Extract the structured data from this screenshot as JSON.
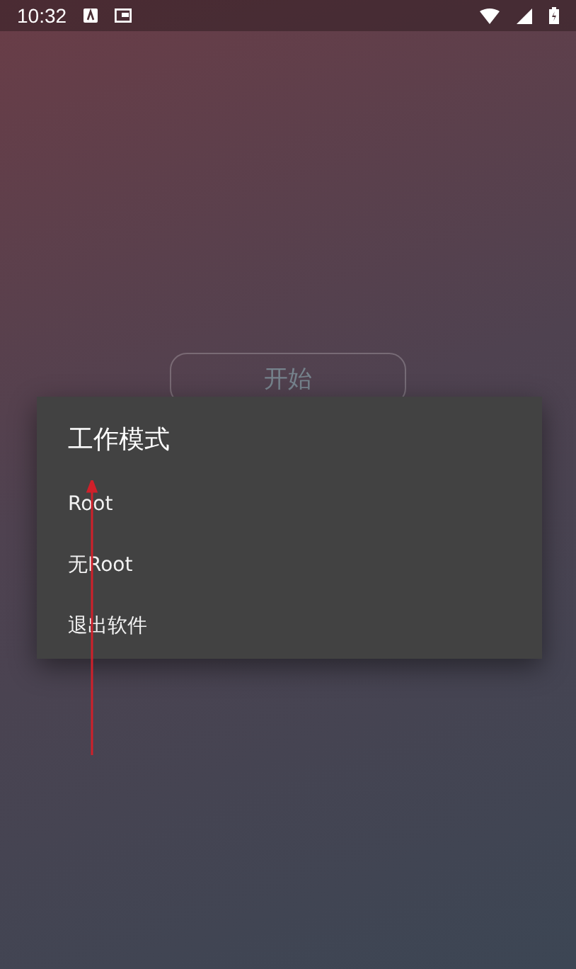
{
  "status_bar": {
    "time": "10:32"
  },
  "start_button": {
    "label": "开始"
  },
  "dialog": {
    "title": "工作模式",
    "items": [
      {
        "label": "Root"
      },
      {
        "label": "无Root"
      },
      {
        "label": "退出软件"
      }
    ]
  }
}
